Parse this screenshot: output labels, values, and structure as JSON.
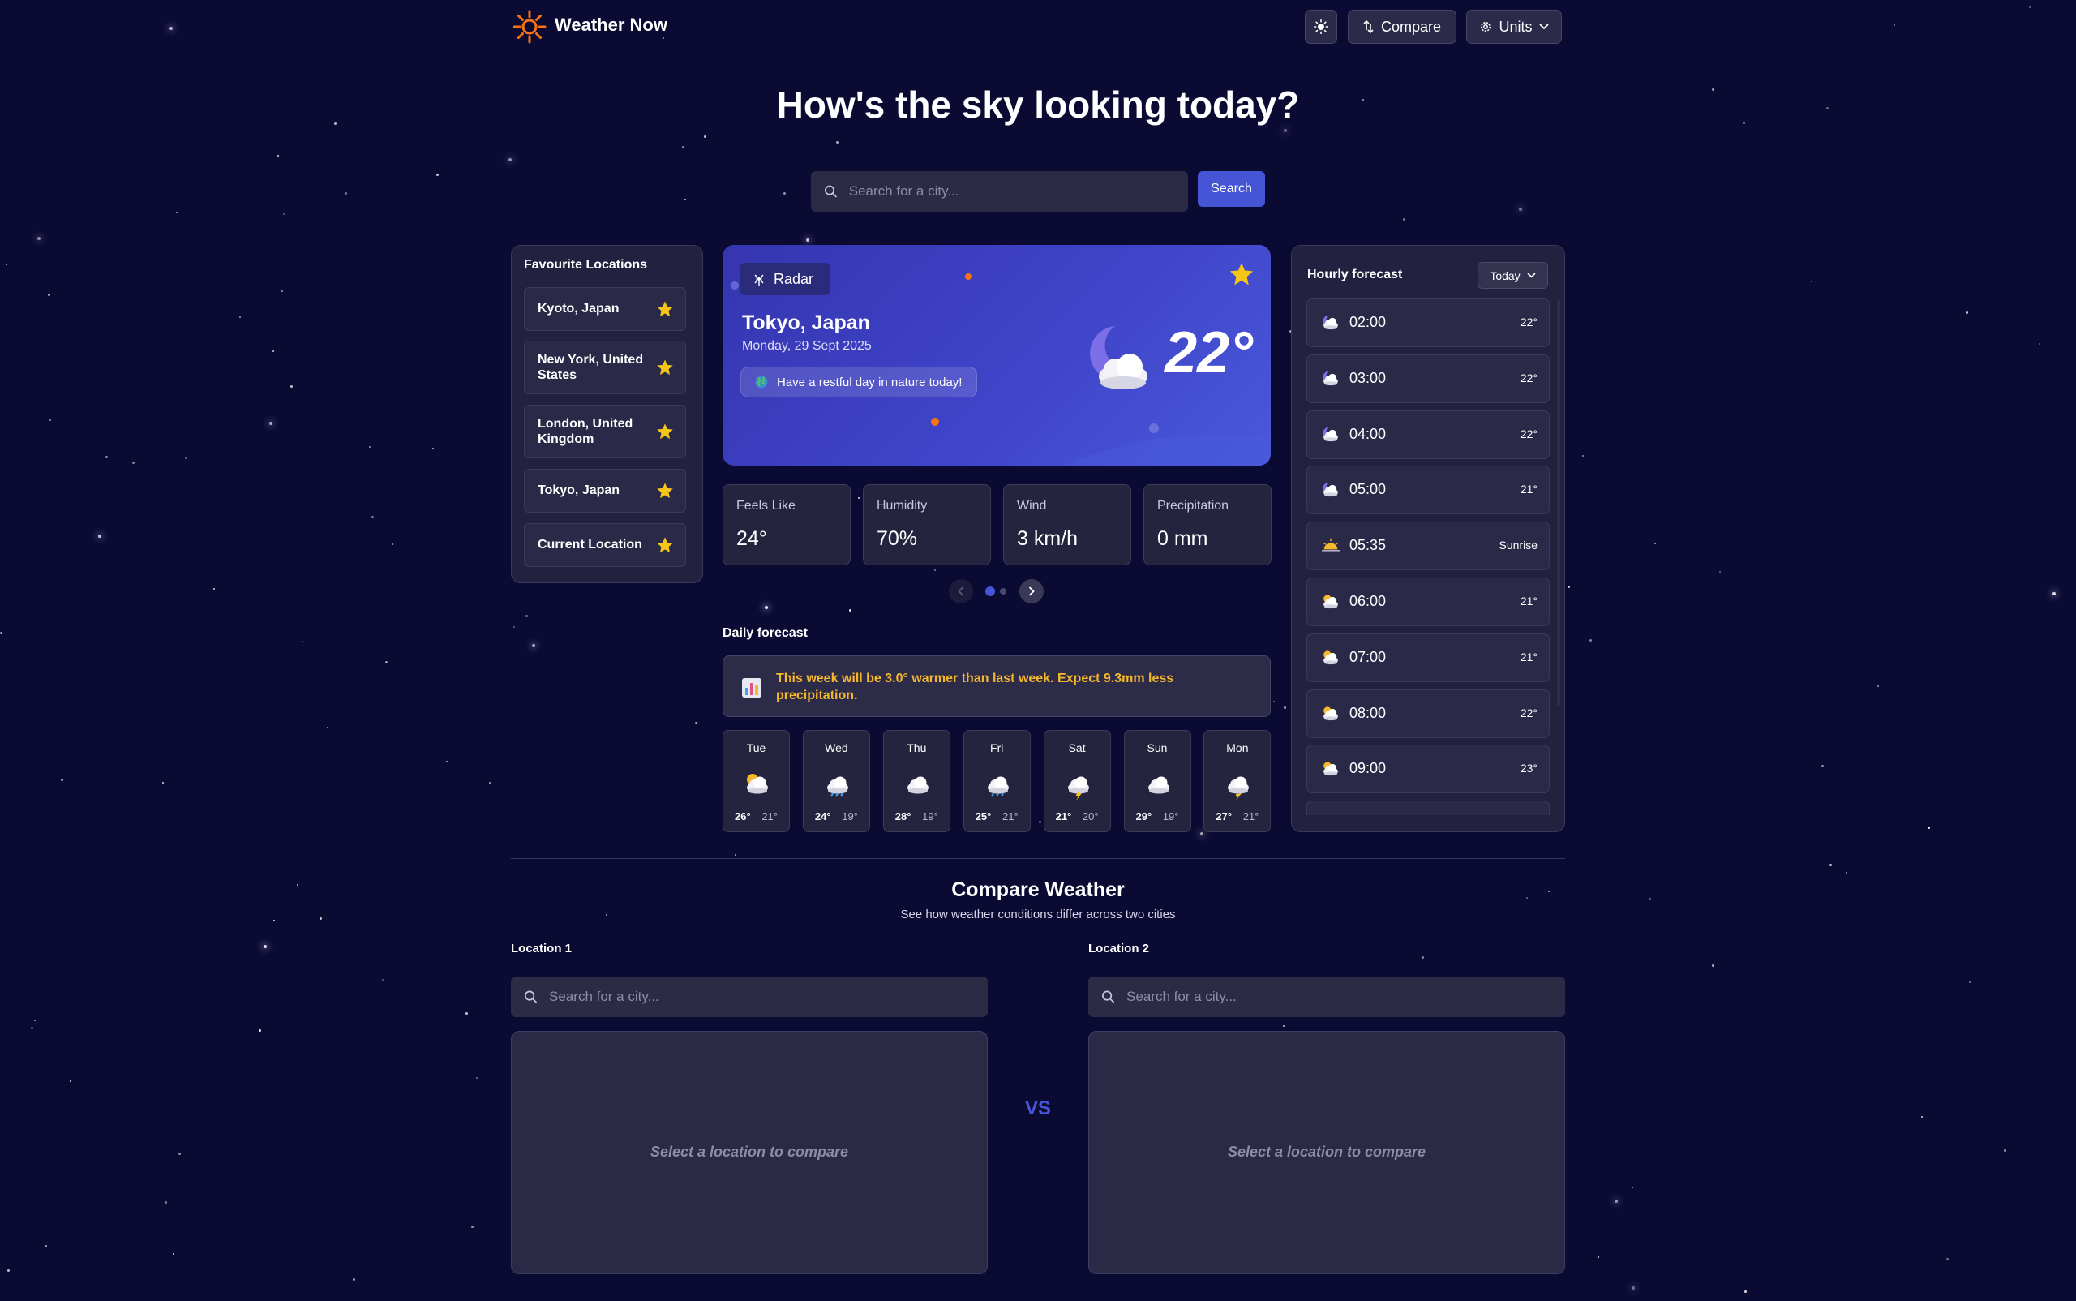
{
  "header": {
    "app_title": "Weather Now",
    "compare_label": "Compare",
    "units_label": "Units"
  },
  "hero": {
    "title": "How's the sky looking today?",
    "search_placeholder": "Search for a city...",
    "search_button": "Search"
  },
  "favourites": {
    "title": "Favourite Locations",
    "items": [
      {
        "label": "Kyoto, Japan"
      },
      {
        "label": "New York, United States"
      },
      {
        "label": "London, United Kingdom"
      },
      {
        "label": "Tokyo, Japan"
      },
      {
        "label": "Current Location"
      }
    ]
  },
  "current": {
    "radar_label": "Radar",
    "city": "Tokyo, Japan",
    "date": "Monday, 29 Sept 2025",
    "tip": "Have a restful day in nature today!",
    "temperature": "22°",
    "condition_icon": "moon-cloud-icon"
  },
  "stats": [
    {
      "label": "Feels Like",
      "value": "24°"
    },
    {
      "label": "Humidity",
      "value": "70%"
    },
    {
      "label": "Wind",
      "value": "3 km/h"
    },
    {
      "label": "Precipitation",
      "value": "0 mm"
    }
  ],
  "daily": {
    "title": "Daily forecast",
    "insight": "This week will be 3.0° warmer than last week. Expect 9.3mm less precipitation.",
    "days": [
      {
        "day": "Tue",
        "hi": "26°",
        "lo": "21°",
        "icon": "sun-cloud-icon"
      },
      {
        "day": "Wed",
        "hi": "24°",
        "lo": "19°",
        "icon": "rain-cloud-icon"
      },
      {
        "day": "Thu",
        "hi": "28°",
        "lo": "19°",
        "icon": "cloud-icon"
      },
      {
        "day": "Fri",
        "hi": "25°",
        "lo": "21°",
        "icon": "rain-cloud-icon"
      },
      {
        "day": "Sat",
        "hi": "21°",
        "lo": "20°",
        "icon": "storm-cloud-icon"
      },
      {
        "day": "Sun",
        "hi": "29°",
        "lo": "19°",
        "icon": "cloud-icon"
      },
      {
        "day": "Mon",
        "hi": "27°",
        "lo": "21°",
        "icon": "storm-cloud-icon"
      }
    ]
  },
  "hourly": {
    "title": "Hourly forecast",
    "select_label": "Today",
    "rows": [
      {
        "time": "02:00",
        "value": "22°",
        "icon": "moon-cloud-icon"
      },
      {
        "time": "03:00",
        "value": "22°",
        "icon": "moon-cloud-icon"
      },
      {
        "time": "04:00",
        "value": "22°",
        "icon": "moon-cloud-icon"
      },
      {
        "time": "05:00",
        "value": "21°",
        "icon": "moon-cloud-icon"
      },
      {
        "time": "05:35",
        "value": "Sunrise",
        "icon": "sunrise-icon"
      },
      {
        "time": "06:00",
        "value": "21°",
        "icon": "sun-cloud-icon"
      },
      {
        "time": "07:00",
        "value": "21°",
        "icon": "sun-cloud-icon"
      },
      {
        "time": "08:00",
        "value": "22°",
        "icon": "sun-cloud-icon"
      },
      {
        "time": "09:00",
        "value": "23°",
        "icon": "sun-cloud-icon"
      }
    ]
  },
  "compare": {
    "title": "Compare Weather",
    "subtitle": "See how weather conditions differ across two cities",
    "location1_label": "Location 1",
    "location2_label": "Location 2",
    "placeholder": "Search for a city...",
    "empty_text": "Select a location to compare",
    "vs": "VS"
  },
  "colors": {
    "background": "#0b0a33",
    "accent": "#4654d6",
    "star": "#f5c518",
    "insight_text": "#f5b72c"
  }
}
